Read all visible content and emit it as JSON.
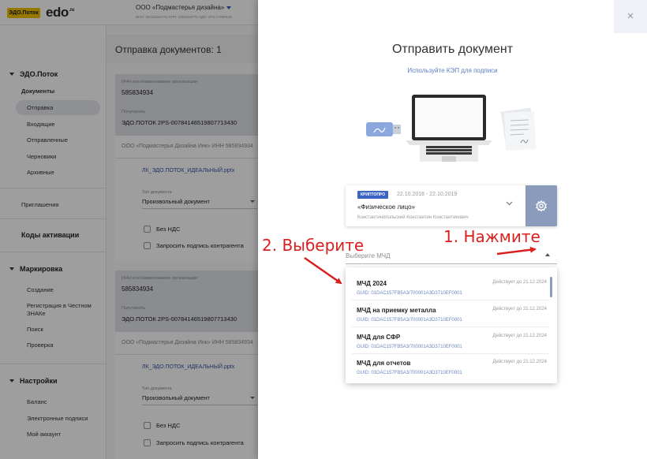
{
  "topbar": {
    "logo_label": "ЭДО.Поток",
    "brand": "edo",
    "brand_suffix": ".ru",
    "org_name": "ООО «Подмастерья дизайна»",
    "org_meta": "ИНН: 3541526377О КПП: 1653263779 ЭДО: 2PS-17080155"
  },
  "sidebar": {
    "section_edo": "ЭДО.Поток",
    "group_documents": "Документы",
    "items_docs": [
      "Отправка",
      "Входящие",
      "Отправленные",
      "Черновики",
      "Архивные"
    ],
    "invites": "Приглашения",
    "activation_codes": "Коды активации",
    "section_marking": "Маркировка",
    "items_marking": [
      "Создание",
      "Регистрация в Честном ЗНАКе",
      "Поиск",
      "Проверка"
    ],
    "section_settings": "Настройки",
    "items_settings": [
      "Баланс",
      "Электронные подписи",
      "Мой аккаунт"
    ]
  },
  "main": {
    "title": "Отправка документов: 1",
    "cards": [
      {
        "inn_label": "ИНН или Наименование организации",
        "inn_value": "585834934",
        "recipient_label": "Получатель",
        "recipient_value": "ЭДО.ПОТОК 2PS-00784146519807713430",
        "org_line": "ООО «Подмастерья Дизайна Инк» ИНН 585834934",
        "file_link": "ЛК_ЭДО.ПОТОК_ИДЕАЛЬНЫЙ.pptx",
        "doctype_label": "Тип документа",
        "doctype_value": "Произвольный документ",
        "no_vat": "Без НДС",
        "request_sign": "Запросить подпись контрагента"
      },
      {
        "inn_label": "ИНН или Наименование организации",
        "inn_value": "585834934",
        "recipient_label": "Получатель",
        "recipient_value": "ЭДО.ПОТОК 2PS-00784146519807713430",
        "org_line": "ООО «Подмастерья Дизайна Инк» ИНН 585834934",
        "file_link": "ЛК_ЭДО.ПОТОК_ИДЕАЛЬНЫЙ.pptx",
        "doctype_label": "Тип документа",
        "doctype_value": "Произвольный документ",
        "no_vat": "Без НДС",
        "request_sign": "Запросить подпись контрагента"
      }
    ]
  },
  "modal": {
    "close_label": "×",
    "title": "Отправить документ",
    "subtitle": "Используйте КЭП для подписи",
    "certificate": {
      "badge": "КРИПТОПРО",
      "dates": "22.10.2018 - 22.10.2019",
      "name": "«Физическое лицо»",
      "holder": "Константинопольский Константин Константинович"
    },
    "mcd_label": "Выберите МЧД",
    "mcd_options": [
      {
        "name": "МЧД 2024",
        "until": "Действует до 21.12.2024",
        "guid": "GUID: 01DAC157FB5A3/700001A3D3710EF0001"
      },
      {
        "name": "МЧД на приемку металла",
        "until": "Действует до 21.12.2024",
        "guid": "GUID: 01DAC157FB5A3/700001A3D3710EF0001"
      },
      {
        "name": "МЧД для СФР",
        "until": "Действует до 21.12.2024",
        "guid": "GUID: 01DAC157FB5A3/700001A3D3710EF0001"
      },
      {
        "name": "МЧД для отчетов",
        "until": "Действует до 21.12.2024",
        "guid": "GUID: 01DAC157FB5A3/700001A3D3710EF0001"
      }
    ]
  },
  "annotations": {
    "step1": "1. Нажмите",
    "step2": "2. Выберите",
    "color": "#d9201f"
  },
  "colors": {
    "accent": "#3b63c4",
    "link": "#3a55a8",
    "gear_button": "#8b9bbb",
    "logo_yellow": "#f2c200"
  }
}
